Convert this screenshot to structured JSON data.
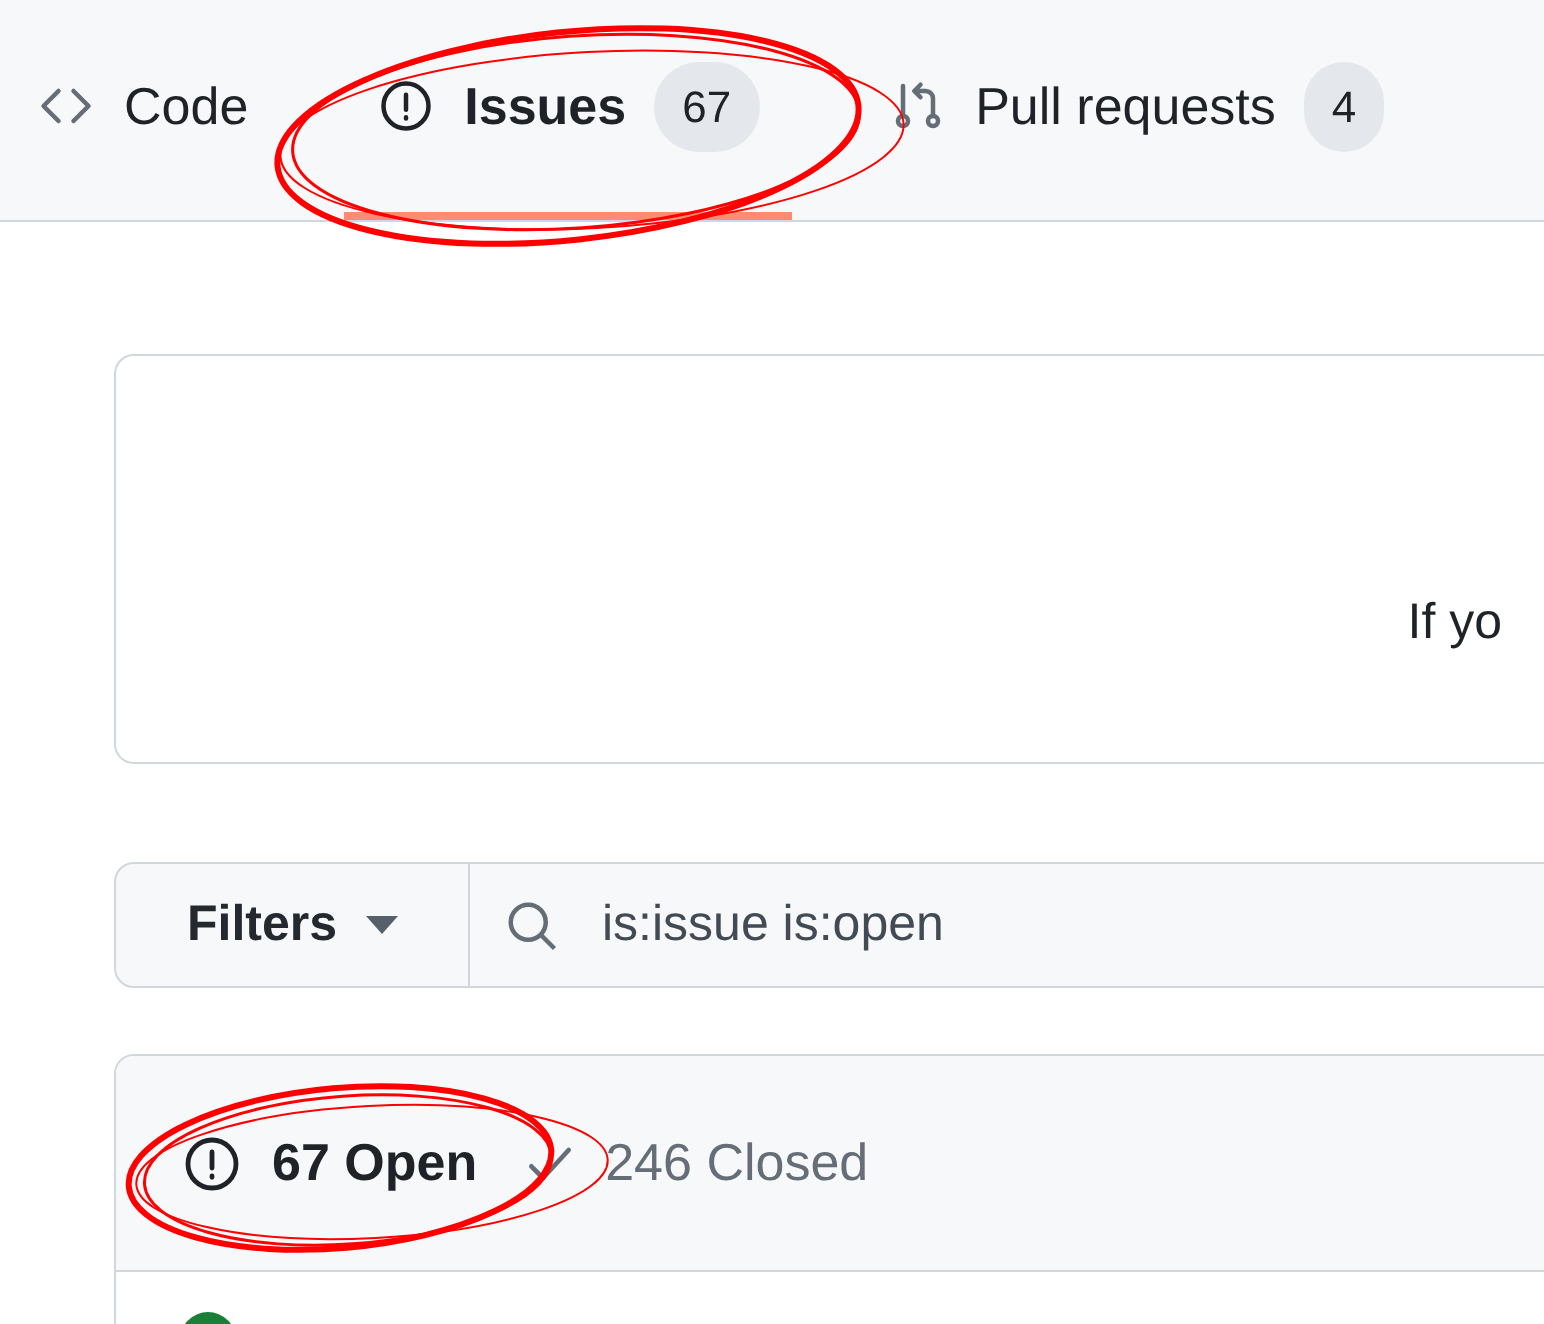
{
  "tabs": [
    {
      "kind": "code",
      "label": "Code",
      "selected": false
    },
    {
      "kind": "issues",
      "label": "Issues",
      "counter": "67",
      "selected": true
    },
    {
      "kind": "pulls",
      "label": "Pull requests",
      "counter": "4",
      "selected": false
    }
  ],
  "banner": {
    "text": "If yo"
  },
  "filters": {
    "button": "Filters",
    "search_value": "is:issue is:open"
  },
  "states": [
    {
      "kind": "open",
      "label": "67 Open",
      "selected": true
    },
    {
      "kind": "closed",
      "label": "246 Closed",
      "selected": false
    }
  ]
}
